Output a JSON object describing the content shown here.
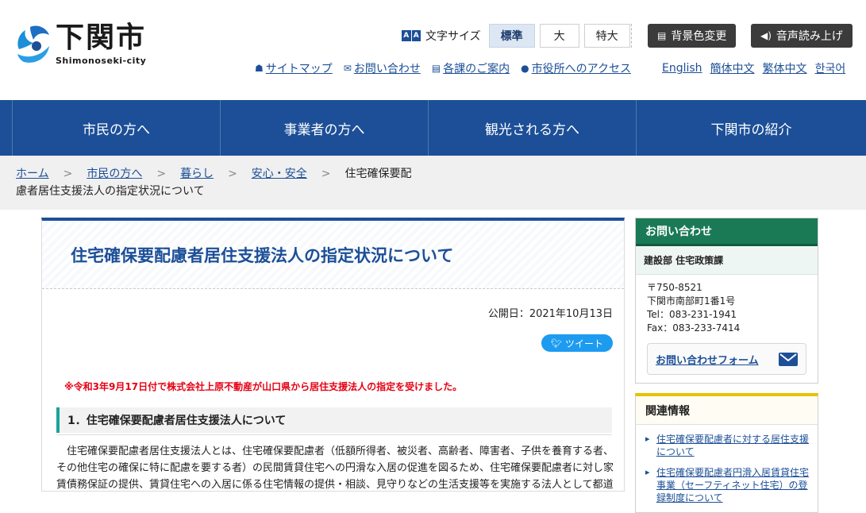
{
  "header": {
    "logo_title": "下関市",
    "logo_sub": "Shimonoseki-city",
    "fontsize": {
      "icon_left": "A",
      "icon_right": "A",
      "label": "文字サイズ",
      "options": [
        "標準",
        "大",
        "特大"
      ],
      "selected": "標準"
    },
    "bg_change_label": "背景色変更",
    "voice_label": "音声読み上げ",
    "utility_links": [
      "サイトマップ",
      "お問い合わせ",
      "各課のご案内",
      "市役所へのアクセス"
    ],
    "languages": [
      "English",
      "簡体中文",
      "繁体中文",
      "한국어"
    ]
  },
  "gnav": [
    "市民の方へ",
    "事業者の方へ",
    "観光される方へ",
    "下関市の紹介"
  ],
  "breadcrumb": {
    "links": [
      "ホーム",
      "市民の方へ",
      "暮らし",
      "安心・安全"
    ],
    "current_line1": "住宅確保要配",
    "current_line2": "慮者居住支援法人の指定状況について"
  },
  "main": {
    "title": "住宅確保要配慮者居住支援法人の指定状況について",
    "published": "公開日：2021年10月13日",
    "tweet_label": "ツイート",
    "notice": "※令和3年9月17日付で株式会社上原不動産が山口県から居住支援法人の指定を受けました。",
    "section1_heading": "1．住宅確保要配慮者居住支援法人について",
    "section1_body": "住宅確保要配慮者居住支援法人とは、住宅確保要配慮者（低額所得者、被災者、高齢者、障害者、子供を養育する者、その他住宅の確保に特に配慮を要する者）の民間賃貸住宅への円滑な入居の促進を図るため、住宅確保要配慮者に対し家賃債務保証の提供、賃貸住宅への入居に係る住宅情報の提供・相談、見守りなどの生活支援等を実施する法人として都道府県が"
  },
  "side": {
    "contact_head": "お問い合わせ",
    "dept": "建設部 住宅政策課",
    "postal": "〒750-8521",
    "address": "下関市南部町1番1号",
    "tel": "Tel：083-231-1941",
    "fax": "Fax：083-233-7414",
    "form_label": "お問い合わせフォーム",
    "related_head": "関連情報",
    "related_links": [
      "住宅確保要配慮者に対する居住支援について",
      "住宅確保要配慮者円滑入居賃貸住宅事業（セーフティネット住宅）の登録制度について"
    ]
  },
  "colors": {
    "brand_blue": "#1c4f97",
    "contact_green": "#1b7a56",
    "notice_red": "#e60012",
    "heading_teal": "#1aa39a",
    "related_yellow": "#e6c300"
  },
  "icons": [
    "logo-mark",
    "font-size-icon",
    "palette-icon",
    "speaker-icon",
    "sitemap-icon",
    "mail-icon",
    "doc-icon",
    "pin-icon",
    "twitter-icon",
    "chevron-right-icon"
  ]
}
